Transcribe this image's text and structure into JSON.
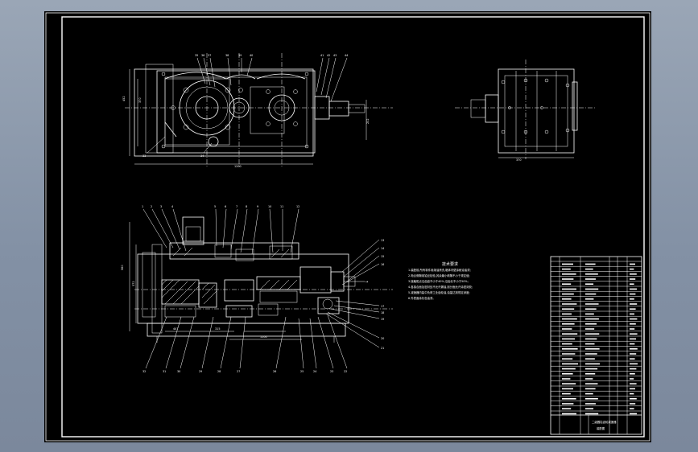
{
  "colors": {
    "background": "#000000",
    "lines": "#ffffff",
    "window": "#8797ab"
  },
  "top_view": {
    "balloons": [
      "35",
      "36",
      "37",
      "38",
      "39",
      "40",
      "41",
      "42",
      "43",
      "44"
    ],
    "side_balloons": [
      "33",
      "34"
    ],
    "dims": {
      "width": "1200",
      "height_a": "452",
      "height_b": "370",
      "shaft": "202"
    }
  },
  "side_view": {
    "dims": {
      "width": "370"
    }
  },
  "section_view": {
    "top_balloons": [
      "1",
      "2",
      "3",
      "4",
      "5",
      "6",
      "7",
      "8",
      "9",
      "10",
      "11",
      "12"
    ],
    "right_balloons": [
      "13",
      "14",
      "15",
      "16",
      "17",
      "18",
      "19",
      "20",
      "21"
    ],
    "bottom_balloons": [
      "32",
      "31",
      "30",
      "29",
      "28",
      "27",
      "26",
      "25",
      "24",
      "23",
      "22"
    ],
    "dims": {
      "height_a": "560",
      "height_b": "372",
      "span_a": "447",
      "span_b": "315",
      "span_c": "1100"
    },
    "note_arrow": "→"
  },
  "tech_req": {
    "title": "技术要求",
    "lines": [
      "1.装配前,所有零件用煤油清洗,箱体内壁涂耐油油漆;",
      "2.啮合侧隙用铅丝检验,其余最小侧隙不小于规定值;",
      "3.接触斑点沿齿高不小于40%,沿齿长不小于50%;",
      "4.各接合面及密封处不允许漏油,剖分面允许涂密封胶;",
      "5.减速器内装中负荷工业齿轮油,油量达到规定深度;",
      "6.外表面涂灰色油漆。"
    ]
  },
  "title_block": {
    "line1": "二级圆柱齿轮减速器",
    "line2": "装配图"
  }
}
